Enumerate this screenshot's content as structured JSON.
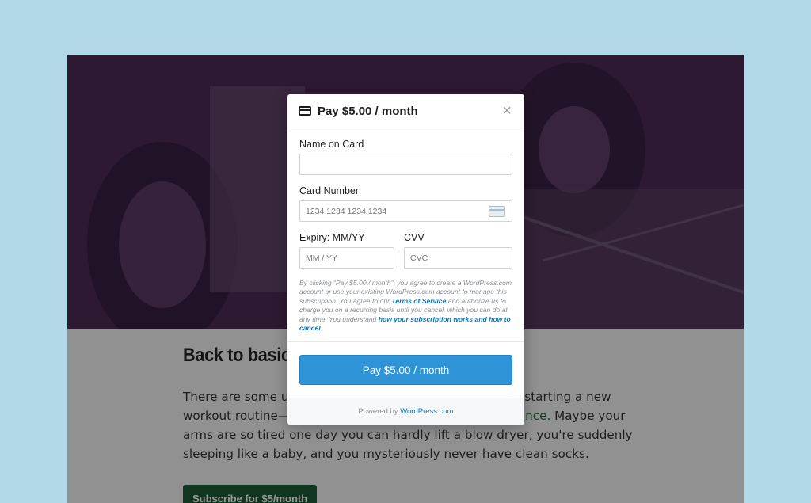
{
  "post": {
    "title": "Back to basics",
    "body_before_link": "There are some unexpected perks that come along with starting a new workout routine—and I don't just mean ",
    "body_link": "improved endurance.",
    "body_after_link": " Maybe your arms are so tired one day you can hardly lift a blow dryer, you're suddenly sleeping like a baby, and you mysteriously never have clean socks.",
    "subscribe_label": "Subscribe for $5/month"
  },
  "modal": {
    "title": "Pay $5.00 / month",
    "close": "×",
    "name_label": "Name on Card",
    "name_value": "",
    "card_label": "Card Number",
    "card_placeholder": "1234 1234 1234 1234",
    "expiry_label": "Expiry: MM/YY",
    "expiry_placeholder": "MM / YY",
    "cvv_label": "CVV",
    "cvv_placeholder": "CVC",
    "terms_1": "By clicking “Pay $5.00 / month”, you agree to create a WordPress.com account or use your existing WordPress.com account to manage this subscription. You agree to our ",
    "terms_link_1": "Terms of Service",
    "terms_2": " and authorize us to charge you on a recurring basis until you cancel, which you can do at any time. You understand ",
    "terms_link_2": "how your subscription works and how to cancel",
    "terms_3": ".",
    "pay_label": "Pay $5.00 / month",
    "powered_prefix": "Powered by ",
    "powered_brand": "WordPress.com"
  },
  "colors": {
    "background": "#b3d9e8",
    "hero": "#4a2a52",
    "primary_button": "#2f93d8",
    "link": "#0675c4",
    "subscribe_button": "#1d5b35"
  }
}
